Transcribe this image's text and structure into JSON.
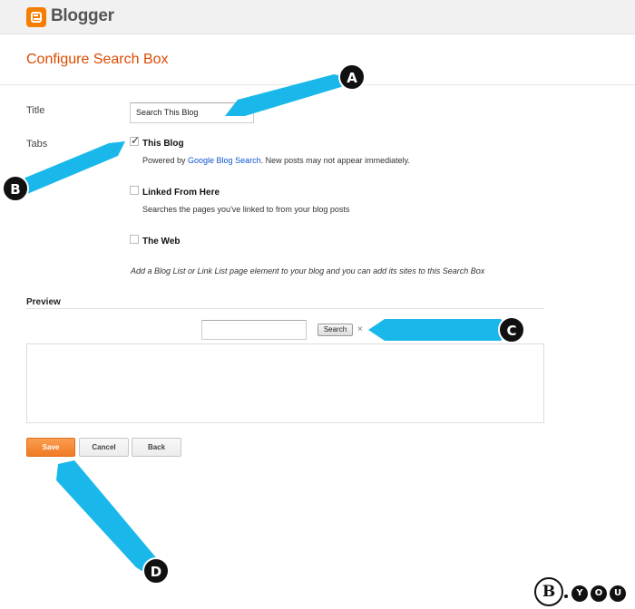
{
  "header": {
    "logo_icon": "blogger-logo-icon",
    "brand": "Blogger"
  },
  "page_title": "Configure Search Box",
  "form": {
    "title_label": "Title",
    "title_value": "Search This Blog",
    "tabs_label": "Tabs",
    "options": [
      {
        "label": "This Blog",
        "checked": true,
        "desc_prefix": "Powered by ",
        "desc_link": "Google Blog Search",
        "desc_suffix": ". New posts may not appear immediately."
      },
      {
        "label": "Linked From Here",
        "checked": false,
        "desc": "Searches the pages you've linked to from your blog posts"
      },
      {
        "label": "The Web",
        "checked": false
      }
    ],
    "note": "Add a Blog List or Link List page element to your blog and you can add its sites to this Search Box"
  },
  "preview": {
    "label": "Preview",
    "search_button": "Search",
    "close_glyph": "×"
  },
  "buttons": {
    "save": "Save",
    "cancel": "Cancel",
    "back": "Back"
  },
  "annotations": {
    "color": "#1ab8ea",
    "markers": [
      "A",
      "B",
      "C",
      "D"
    ]
  },
  "watermark": {
    "b": "B",
    "dot": ".",
    "letters": [
      "Y",
      "O",
      "U"
    ]
  }
}
